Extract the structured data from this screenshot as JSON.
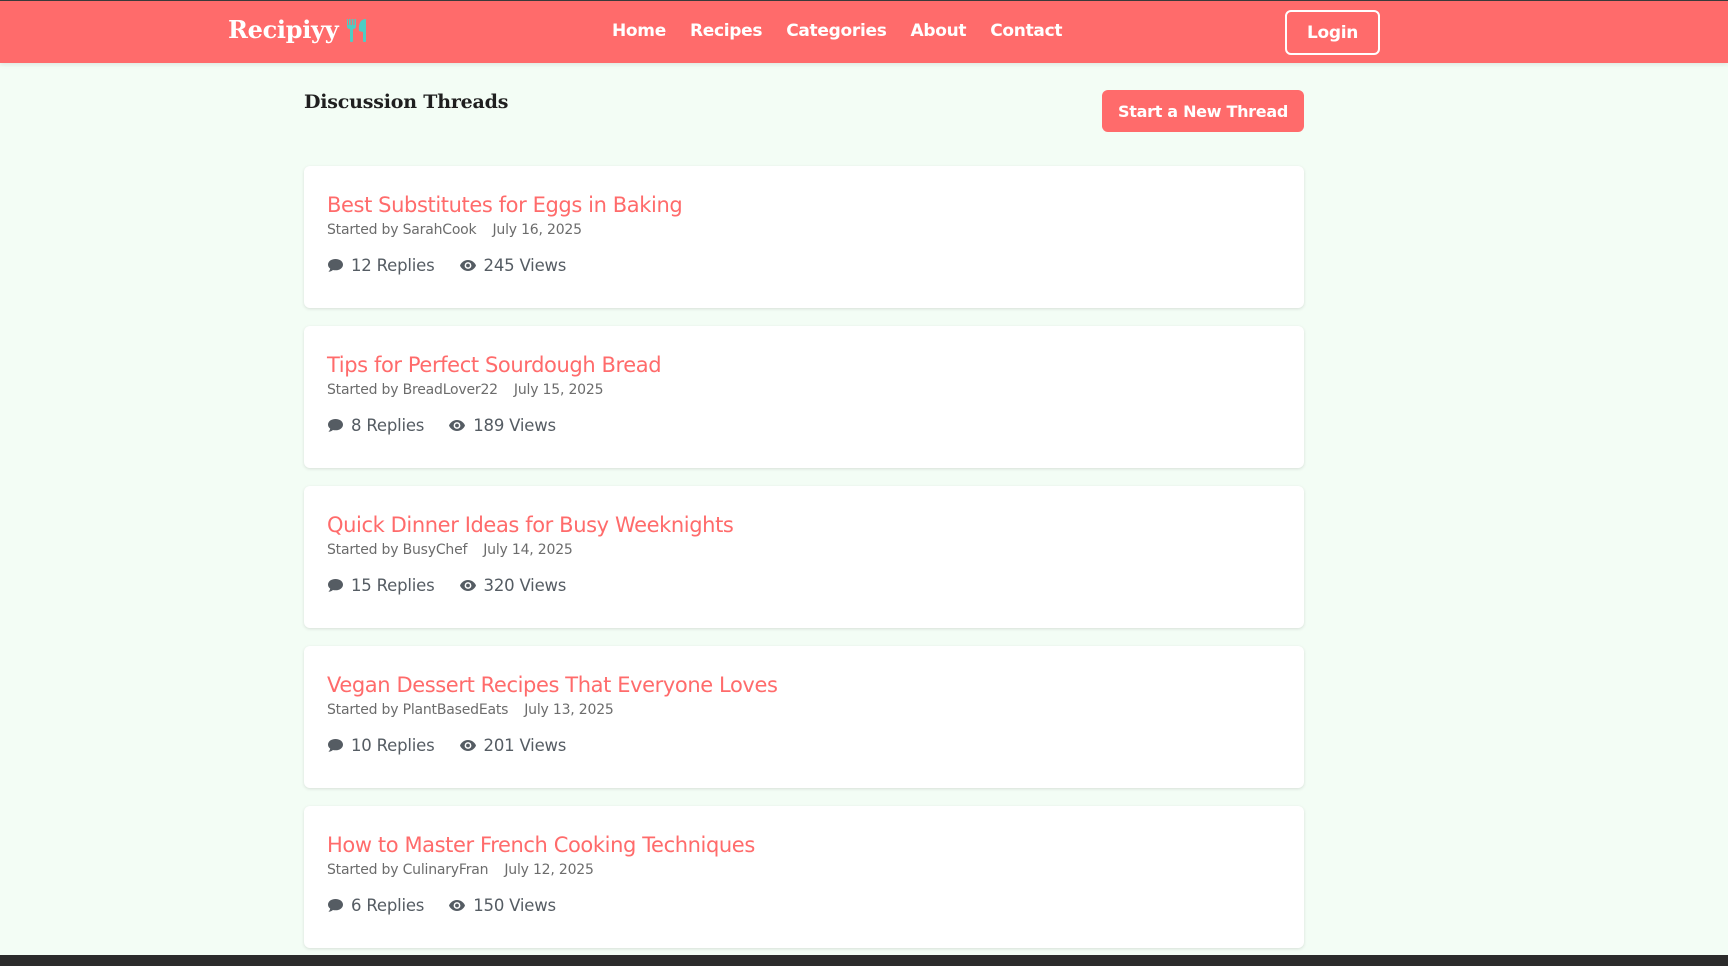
{
  "header": {
    "brand": "Recipiyy",
    "brand_icon": "utensils-icon",
    "nav": [
      "Home",
      "Recipes",
      "Categories",
      "About",
      "Contact"
    ],
    "login_label": "Login"
  },
  "main": {
    "title": "Discussion Threads",
    "new_thread_label": "Start a New Thread",
    "threads": [
      {
        "title": "Best Substitutes for Eggs in Baking",
        "author": "Started by SarahCook",
        "date": "July 16, 2025",
        "replies": "12 Replies",
        "views": "245 Views"
      },
      {
        "title": "Tips for Perfect Sourdough Bread",
        "author": "Started by BreadLover22",
        "date": "July 15, 2025",
        "replies": "8 Replies",
        "views": "189 Views"
      },
      {
        "title": "Quick Dinner Ideas for Busy Weeknights",
        "author": "Started by BusyChef",
        "date": "July 14, 2025",
        "replies": "15 Replies",
        "views": "320 Views"
      },
      {
        "title": "Vegan Dessert Recipes That Everyone Loves",
        "author": "Started by PlantBasedEats",
        "date": "July 13, 2025",
        "replies": "10 Replies",
        "views": "201 Views"
      },
      {
        "title": "How to Master French Cooking Techniques",
        "author": "Started by CulinaryFran",
        "date": "July 12, 2025",
        "replies": "6 Replies",
        "views": "150 Views"
      }
    ]
  },
  "colors": {
    "brand": "#ff6b6b",
    "accent_icon": "#4ecdc4",
    "background": "#f3fdf5"
  },
  "icons": {
    "replies": "comment-icon",
    "views": "eye-icon"
  }
}
